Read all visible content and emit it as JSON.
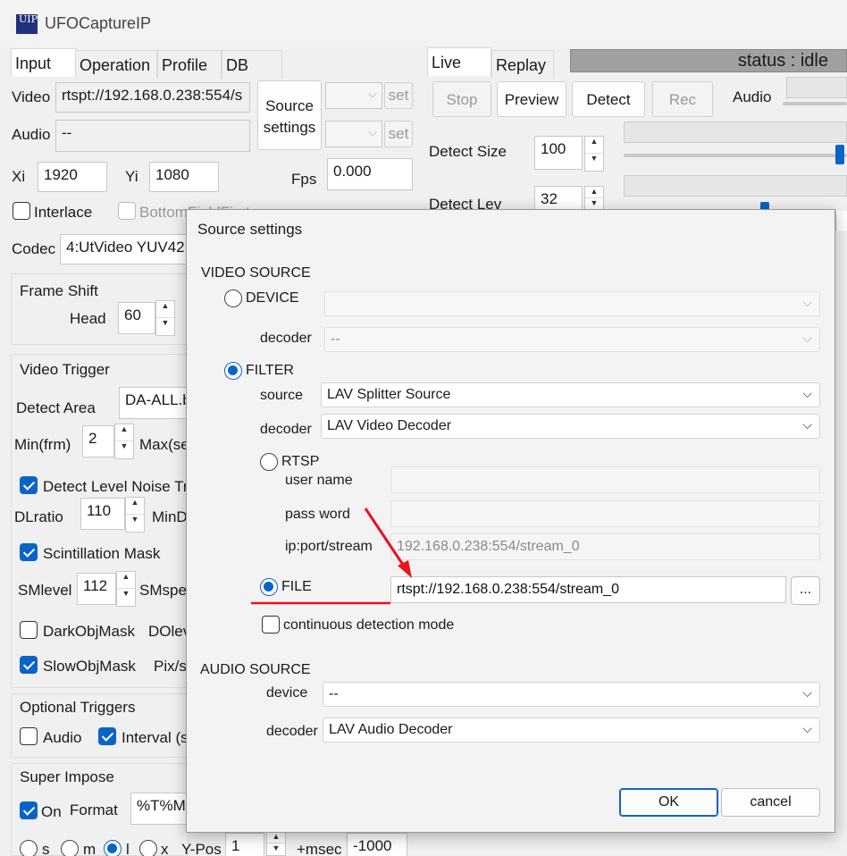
{
  "app": {
    "title": "UFOCaptureIP",
    "logo": "UIP"
  },
  "tabs_left": [
    {
      "label": "Input"
    },
    {
      "label": "Operation"
    },
    {
      "label": "Profile"
    },
    {
      "label": "DB"
    }
  ],
  "tabs_right": [
    {
      "label": "Live"
    },
    {
      "label": "Replay"
    }
  ],
  "status": "status : idle",
  "input": {
    "video_label": "Video",
    "video_value": "rtspt://192.168.0.238:554/s",
    "audio_label": "Audio",
    "audio_value": "--",
    "source_settings_label": "Source settings",
    "set_label": "set",
    "xi_label": "Xi",
    "xi_value": "1920",
    "yi_label": "Yi",
    "yi_value": "1080",
    "fps_label": "Fps",
    "fps_value": "0.000",
    "interlace_label": "Interlace",
    "bottomfield_label": "BottomFieldFirst",
    "codec_label": "Codec",
    "codec_value": "4:UtVideo YUV42",
    "frameshift_label": "Frame Shift",
    "head_label": "Head",
    "head_value": "60",
    "videotrigger_label": "Video Trigger",
    "detectarea_label": "Detect Area",
    "detectarea_value": "DA-ALL.b",
    "minfrm_label": "Min(frm)",
    "minfrm_value": "2",
    "maxsec_label": "Max(se",
    "detectlevelnoise_label": "Detect Level Noise Tr",
    "dlratio_label": "DLratio",
    "dlratio_value": "110",
    "mind_label": "MinD",
    "scintillation_label": "Scintillation Mask",
    "smlevel_label": "SMlevel",
    "smlevel_value": "112",
    "smspe_label": "SMspe",
    "darkobj_label": "DarkObjMask",
    "dolev_label": "DOlev",
    "slowobj_label": "SlowObjMask",
    "pixs_label": "Pix/s",
    "optional_label": "Optional Triggers",
    "opt_audio_label": "Audio",
    "opt_interval_label": "Interval (s",
    "superimpose_label": "Super Impose",
    "on_label": "On",
    "format_label": "Format",
    "format_value": "%T%M",
    "pos_s": "s",
    "pos_m": "m",
    "pos_l": "l",
    "pos_x": "x",
    "ypos_label": "Y-Pos",
    "ypos_value": "1",
    "msec_label": "+msec",
    "msec_value": "-1000"
  },
  "live": {
    "stop_label": "Stop",
    "preview_label": "Preview",
    "detect_label": "Detect",
    "rec_label": "Rec",
    "audio_label": "Audio",
    "detectsize_label": "Detect Size",
    "detectsize_value": "100",
    "detectlev_label": "Detect Lev",
    "detectlev_value": "32"
  },
  "dialog": {
    "title": "Source settings",
    "video_source_label": "VIDEO SOURCE",
    "device_label": "DEVICE",
    "decoder_label": "decoder",
    "device_decoder_value": "--",
    "filter_label": "FILTER",
    "source_label": "source",
    "source_value": "LAV Splitter Source",
    "filter_decoder_value": "LAV Video Decoder",
    "rtsp_label": "RTSP",
    "username_label": "user name",
    "password_label": "pass word",
    "ipport_label": "ip:port/stream",
    "ipport_value": "192.168.0.238:554/stream_0",
    "file_label": "FILE",
    "file_value": "rtspt://192.168.0.238:554/stream_0",
    "browse_label": "...",
    "continuous_label": "continuous detection mode",
    "audio_source_label": "AUDIO SOURCE",
    "audio_device_label": "device",
    "audio_device_value": "--",
    "audio_decoder_label": "decoder",
    "audio_decoder_value": "LAV Audio Decoder",
    "ok_label": "OK",
    "cancel_label": "cancel"
  },
  "colors": {
    "accent": "#0a64c8",
    "annotation": "#e8141a",
    "status_bg": "#a0a0a0"
  }
}
